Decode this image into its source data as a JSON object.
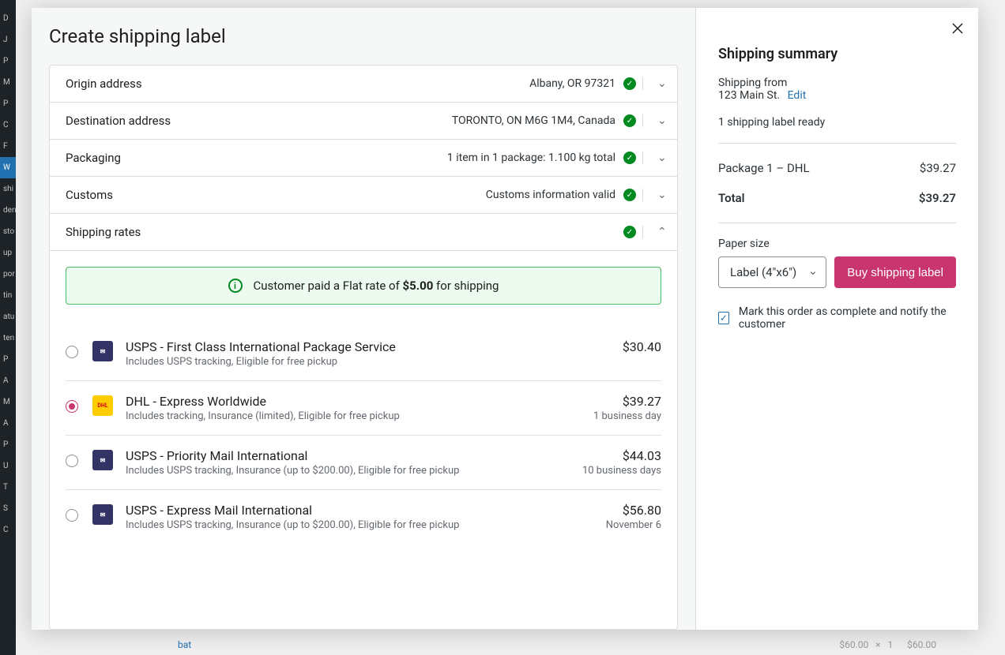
{
  "background_sidebar_items": [
    "D",
    "J",
    "P",
    "M",
    "P",
    "C",
    "F",
    "W",
    "shi",
    "den",
    "sto",
    "up",
    "por",
    "tin",
    "atu",
    "ten",
    "P",
    "A",
    "M",
    "A",
    "P",
    "U",
    "T",
    "S",
    "C"
  ],
  "background_row": {
    "name": "bat",
    "price1": "$60.00",
    "qty": "1",
    "price2": "$60.00"
  },
  "modal": {
    "title": "Create shipping label",
    "sections": {
      "origin": {
        "label": "Origin address",
        "summary": "Albany, OR  97321"
      },
      "destination": {
        "label": "Destination address",
        "summary": "TORONTO, ON  M6G 1M4, Canada"
      },
      "packaging": {
        "label": "Packaging",
        "summary": "1 item in 1 package: 1.100 kg total"
      },
      "customs": {
        "label": "Customs",
        "summary": "Customs information valid"
      },
      "rates": {
        "label": "Shipping rates"
      }
    },
    "info_banner_prefix": "Customer paid a Flat rate of ",
    "info_banner_bold": "$5.00",
    "info_banner_suffix": " for shipping",
    "rates": [
      {
        "carrier": "usps",
        "name": "USPS - First Class International Package Service",
        "desc": "Includes USPS tracking, Eligible for free pickup",
        "price": "$30.40",
        "eta": "",
        "selected": false
      },
      {
        "carrier": "dhl",
        "name": "DHL - Express Worldwide",
        "desc": "Includes tracking, Insurance (limited), Eligible for free pickup",
        "price": "$39.27",
        "eta": "1 business day",
        "selected": true
      },
      {
        "carrier": "usps",
        "name": "USPS - Priority Mail International",
        "desc": "Includes USPS tracking, Insurance (up to $200.00), Eligible for free pickup",
        "price": "$44.03",
        "eta": "10 business days",
        "selected": false
      },
      {
        "carrier": "usps",
        "name": "USPS - Express Mail International",
        "desc": "Includes USPS tracking, Insurance (up to $200.00), Eligible for free pickup",
        "price": "$56.80",
        "eta": "November 6",
        "selected": false
      }
    ]
  },
  "summary": {
    "title": "Shipping summary",
    "from_label": "Shipping from",
    "from_address": "123 Main St.",
    "edit": "Edit",
    "ready": "1 shipping label ready",
    "package_line": "Package 1 – DHL",
    "package_price": "$39.27",
    "total_label": "Total",
    "total_price": "$39.27",
    "paper_label": "Paper size",
    "paper_value": "Label (4\"x6\")",
    "buy_label": "Buy shipping label",
    "mark_complete": "Mark this order as complete and notify the customer",
    "mark_checked": true
  }
}
